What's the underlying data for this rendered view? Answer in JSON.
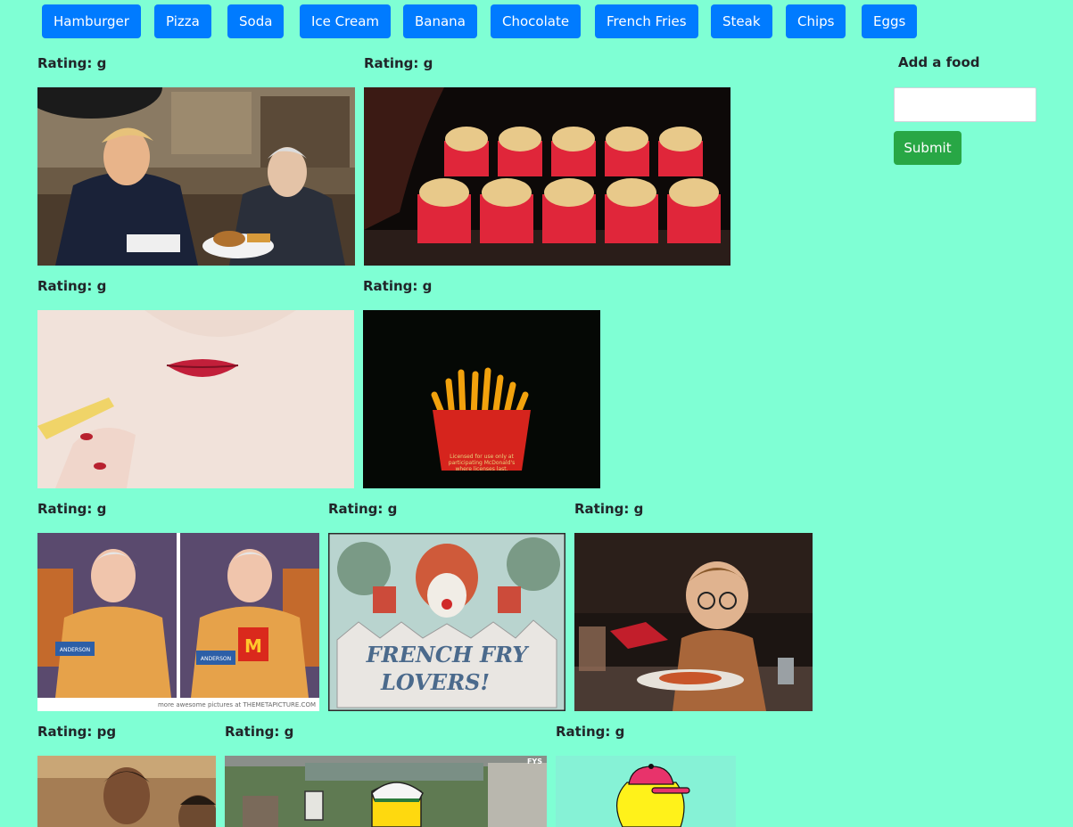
{
  "buttons": [
    "Hamburger",
    "Pizza",
    "Soda",
    "Ice Cream",
    "Banana",
    "Chocolate",
    "French Fries",
    "Steak",
    "Chips",
    "Eggs"
  ],
  "form": {
    "title": "Add a food",
    "input_value": "",
    "input_placeholder": "",
    "submit": "Submit"
  },
  "gifs": [
    {
      "rating": "Rating: g",
      "scene": "politicians-burger"
    },
    {
      "rating": "Rating: g",
      "scene": "fries-conveyor"
    },
    {
      "rating": "Rating: g",
      "scene": "lips-fry"
    },
    {
      "rating": "Rating: g",
      "scene": "fries-carton",
      "caption_1": "Licensed for use only at",
      "caption_2": "participating McDonald's",
      "caption_3": "where licenses last."
    },
    {
      "rating": "Rating: g",
      "scene": "fries-shirt",
      "badge": "ANDERSON",
      "logo": "M",
      "credit": "more awesome pictures at THEMETAPICTURE.COM"
    },
    {
      "rating": "Rating: g",
      "scene": "french-fry-lovers",
      "title_1": "FRENCH FRY",
      "title_2": "LOVERS!"
    },
    {
      "rating": "Rating: g",
      "scene": "kid-ketchup"
    },
    {
      "rating": "Rating: pg",
      "scene": "young-man"
    },
    {
      "rating": "Rating: g",
      "scene": "cartoon-cook",
      "watermark": "FYS"
    },
    {
      "rating": "Rating: g",
      "scene": "cartoon-cap"
    }
  ],
  "colors": {
    "background": "#7fffd4",
    "primary": "#007bff",
    "success": "#28a745"
  }
}
